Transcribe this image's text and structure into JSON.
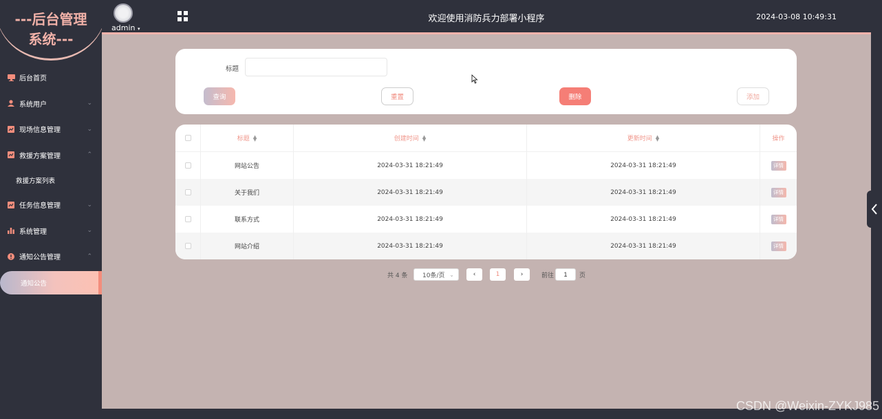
{
  "sidebar": {
    "logo_line1": "---后台管理",
    "logo_line2": "系统---",
    "items": [
      {
        "label": "后台首页",
        "icon": "monitor-icon",
        "has_chevron": false
      },
      {
        "label": "系统用户",
        "icon": "user-icon",
        "has_chevron": true
      },
      {
        "label": "现场信息管理",
        "icon": "chart-icon",
        "has_chevron": true
      },
      {
        "label": "救援方案管理",
        "icon": "chart-icon",
        "has_chevron": true,
        "expanded": true
      },
      {
        "label": "任务信息管理",
        "icon": "chart-icon",
        "has_chevron": true
      },
      {
        "label": "系统管理",
        "icon": "bar-chart-icon",
        "has_chevron": true
      },
      {
        "label": "通知公告管理",
        "icon": "info-icon",
        "has_chevron": true,
        "expanded": true
      }
    ],
    "sub_rescue": "救援方案列表",
    "sub_notice_active": "通知公告",
    "icon_color": "#f38d7c"
  },
  "topbar": {
    "user": "admin",
    "title": "欢迎使用消防兵力部署小程序",
    "datetime": "2024-03-08 10:49:31"
  },
  "search": {
    "title_label": "标题",
    "title_value": "",
    "query_label": "查询",
    "reset_label": "重置",
    "delete_label": "删除",
    "add_label": "添加"
  },
  "table": {
    "headers": {
      "title": "标题",
      "create_time": "创建时间",
      "update_time": "更新时间",
      "actions": "操作"
    },
    "rows": [
      {
        "title": "网站公告",
        "create_time": "2024-03-31 18:21:49",
        "update_time": "2024-03-31 18:21:49",
        "action": "详情"
      },
      {
        "title": "关于我们",
        "create_time": "2024-03-31 18:21:49",
        "update_time": "2024-03-31 18:21:49",
        "action": "详情"
      },
      {
        "title": "联系方式",
        "create_time": "2024-03-31 18:21:49",
        "update_time": "2024-03-31 18:21:49",
        "action": "详情"
      },
      {
        "title": "网站介绍",
        "create_time": "2024-03-31 18:21:49",
        "update_time": "2024-03-31 18:21:49",
        "action": "详情"
      }
    ]
  },
  "pagination": {
    "total": "共 4 条",
    "page_size": "10条/页",
    "current_page": "1",
    "goto_label": "前往",
    "goto_value": "1",
    "page_suffix": "页"
  },
  "watermark": "CSDN @Weixin-ZYKJ985",
  "colors": {
    "sidebar_bg": "#2f313c",
    "main_bg": "#c4b3b1",
    "accent": "#f38d7c",
    "delete": "#f57e76"
  }
}
